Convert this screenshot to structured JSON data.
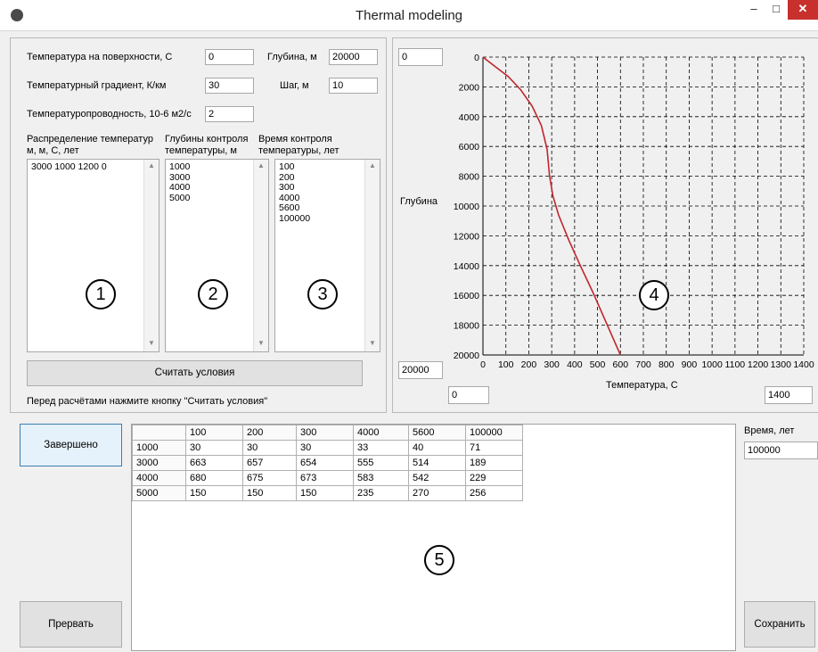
{
  "window": {
    "title": "Thermal modeling",
    "minimize": "–",
    "maximize": "□",
    "close": "✕",
    "app_icon": "paw-icon"
  },
  "params": {
    "surface_temp_label": "Температура на поверхности, С",
    "surface_temp_value": "0",
    "depth_label": "Глубина, м",
    "depth_value": "20000",
    "gradient_label": "Температурный градиент, К/км",
    "gradient_value": "30",
    "step_label": "Шаг, м",
    "step_value": "10",
    "diffusivity_label": "Температуропроводность, 10-6 м2/с",
    "diffusivity_value": "2"
  },
  "lists": {
    "distribution_header": "Распределение температур\nм, м, С, лет",
    "distribution_text": "3000 1000 1200 0",
    "depths_header": "Глубины контроля\nтемпературы, м",
    "depths_text": "1000\n3000\n4000\n5000",
    "times_header": "Время контроля\nтемпературы, лет",
    "times_text": "100\n200\n300\n4000\n5600\n100000"
  },
  "markers": [
    "1",
    "2",
    "3",
    "4",
    "5"
  ],
  "read_button": "Считать условия",
  "hint": "Перед расчётами нажмите кнопку \"Считать условия\"",
  "chart_controls": {
    "depth_min": "0",
    "depth_max": "20000",
    "temp_min": "0",
    "temp_max": "1400"
  },
  "chart_data": {
    "type": "line",
    "xlabel": "Температура, С",
    "ylabel": "Глубина",
    "xlim": [
      0,
      1400
    ],
    "ylim": [
      0,
      20000
    ],
    "y_inverted": true,
    "grid": true,
    "xticks": [
      0,
      100,
      200,
      300,
      400,
      500,
      600,
      700,
      800,
      900,
      1000,
      1100,
      1200,
      1300,
      1400
    ],
    "yticks": [
      0,
      2000,
      4000,
      6000,
      8000,
      10000,
      12000,
      14000,
      16000,
      18000,
      20000
    ],
    "series": [
      {
        "color": "#c0262d",
        "x": [
          0,
          50,
          110,
          165,
          215,
          255,
          280,
          290,
          305,
          330,
          375,
          425,
          480,
          540,
          600
        ],
        "y": [
          0,
          600,
          1300,
          2200,
          3300,
          4600,
          6200,
          7900,
          9300,
          10600,
          12300,
          14000,
          15800,
          17900,
          20000
        ]
      }
    ]
  },
  "done_button": "Завершено",
  "abort_button": "Прервать",
  "save_button": "Сохранить",
  "time_label": "Время, лет",
  "time_value": "100000",
  "results": {
    "columns": [
      "",
      "100",
      "200",
      "300",
      "4000",
      "5600",
      "100000"
    ],
    "rows": [
      [
        "1000",
        "30",
        "30",
        "30",
        "33",
        "40",
        "71"
      ],
      [
        "3000",
        "663",
        "657",
        "654",
        "555",
        "514",
        "189"
      ],
      [
        "4000",
        "680",
        "675",
        "673",
        "583",
        "542",
        "229"
      ],
      [
        "5000",
        "150",
        "150",
        "150",
        "235",
        "270",
        "256"
      ]
    ]
  }
}
